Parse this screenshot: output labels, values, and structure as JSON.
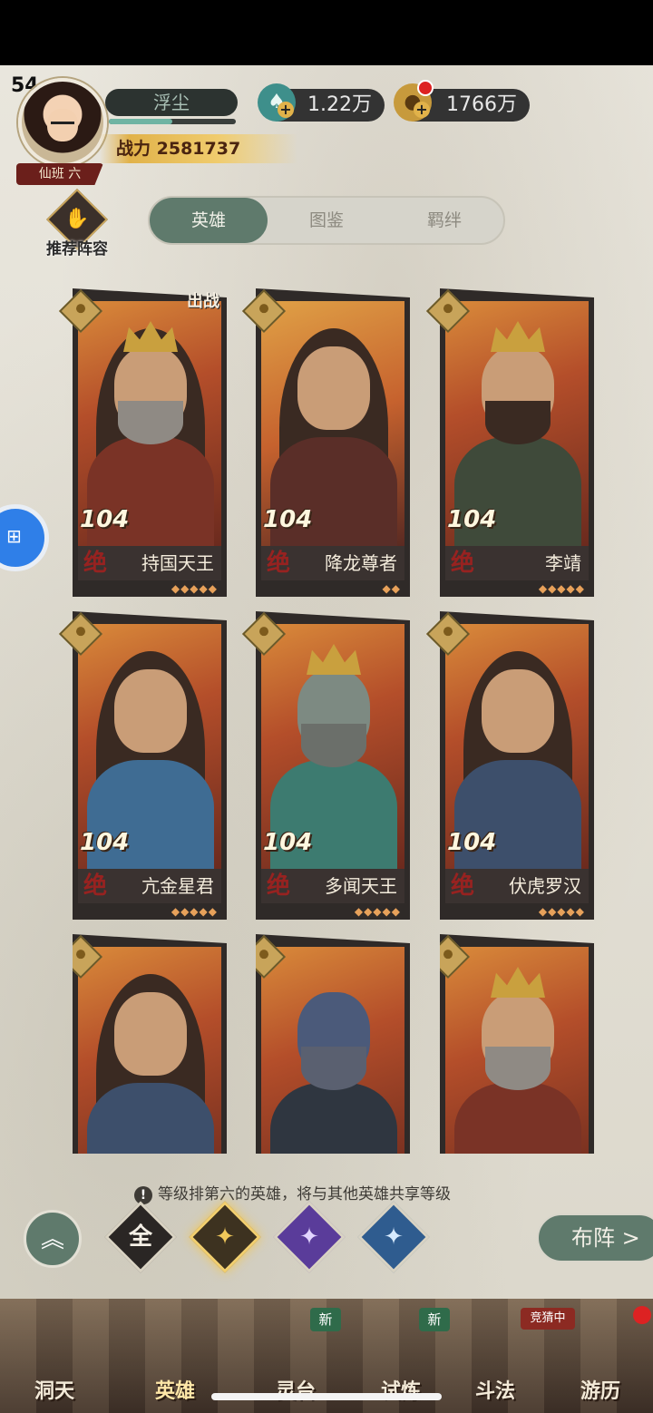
{
  "status": {
    "level": "54"
  },
  "profile": {
    "name": "浮尘",
    "power_label": "战力",
    "power_value": "2581737",
    "rank_tag": "仙班 六",
    "xp_fraction": 0.5
  },
  "currencies": [
    {
      "name": "jade",
      "value": "1.22万"
    },
    {
      "name": "coin",
      "value": "1766万"
    }
  ],
  "recommend": {
    "label": "推荐阵容"
  },
  "tabs": [
    {
      "label": "英雄",
      "active": true
    },
    {
      "label": "图鉴",
      "active": false
    },
    {
      "label": "羁绊",
      "active": false
    }
  ],
  "cards": [
    {
      "level": "104",
      "grade": "绝",
      "name": "持国天王",
      "badge": "出战",
      "stars": 5
    },
    {
      "level": "104",
      "grade": "绝",
      "name": "降龙尊者",
      "stars": 2
    },
    {
      "level": "104",
      "grade": "绝",
      "name": "李靖",
      "stars": 5
    },
    {
      "level": "104",
      "grade": "绝",
      "name": "亢金星君",
      "stars": 5
    },
    {
      "level": "104",
      "grade": "绝",
      "name": "多闻天王",
      "stars": 5
    },
    {
      "level": "104",
      "grade": "绝",
      "name": "伏虎罗汉",
      "stars": 5
    },
    {
      "level": "",
      "grade": "",
      "name": ""
    },
    {
      "level": "",
      "grade": "",
      "name": ""
    },
    {
      "level": "",
      "grade": "",
      "name": ""
    }
  ],
  "notice": {
    "text": "等级排第六的英雄，将与其他英雄共享等级"
  },
  "filters": {
    "all": "全"
  },
  "deploy": {
    "label": "布阵 >"
  },
  "bottom_nav": [
    {
      "label": "洞天"
    },
    {
      "label": "英雄",
      "active": true
    },
    {
      "label": "灵台"
    },
    {
      "label": "试炼"
    },
    {
      "label": "斗法"
    },
    {
      "label": "游历"
    }
  ],
  "nav_tags": {
    "new": "新",
    "compete": "竞猜中"
  }
}
